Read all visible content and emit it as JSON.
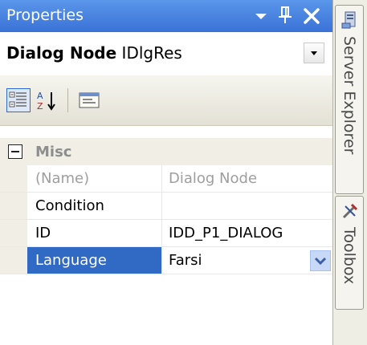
{
  "window": {
    "title": "Properties"
  },
  "object_selector": {
    "name": "Dialog Node",
    "id": "IDlgRes"
  },
  "toolbar": {
    "categorized_icon": "categorized-icon",
    "alphabetical_icon": "alphabetical-sort-icon",
    "property_pages_icon": "property-pages-icon"
  },
  "grid": {
    "category": "Misc",
    "rows": [
      {
        "name": "(Name)",
        "value": "Dialog Node",
        "readonly": true
      },
      {
        "name": "Condition",
        "value": ""
      },
      {
        "name": "ID",
        "value": "IDD_P1_DIALOG"
      },
      {
        "name": "Language",
        "value": "Farsi",
        "selected": true
      }
    ]
  },
  "side_tabs": [
    {
      "label": "Server Explorer",
      "icon": "server-explorer-icon"
    },
    {
      "label": "Toolbox",
      "icon": "toolbox-icon"
    }
  ],
  "colors": {
    "title_bar": "#3f7ce0",
    "selection": "#316ac5"
  }
}
